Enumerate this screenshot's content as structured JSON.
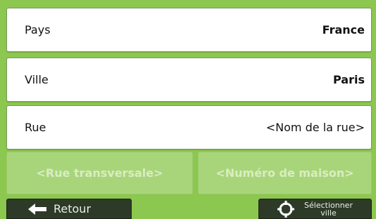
{
  "fields": {
    "pays": {
      "label": "Pays",
      "value": "France"
    },
    "ville": {
      "label": "Ville",
      "value": "Paris"
    },
    "rue": {
      "label": "Rue",
      "value": "<Nom de la rue>"
    }
  },
  "buttons": {
    "cross_street": "<Rue transversale>",
    "house_number": "<Numéro de maison>",
    "back": "Retour",
    "select_city_line1": "Sélectionner",
    "select_city_line2": "ville"
  },
  "icons": {
    "back": "left-arrow-icon",
    "select": "crosshair-icon"
  },
  "colors": {
    "background": "#8cc74f",
    "field_bg": "#ffffff",
    "disabled_button_bg": "#a9d57a",
    "disabled_button_text": "#d8edc3",
    "toolbar_button_bg": "#2e3a28"
  }
}
